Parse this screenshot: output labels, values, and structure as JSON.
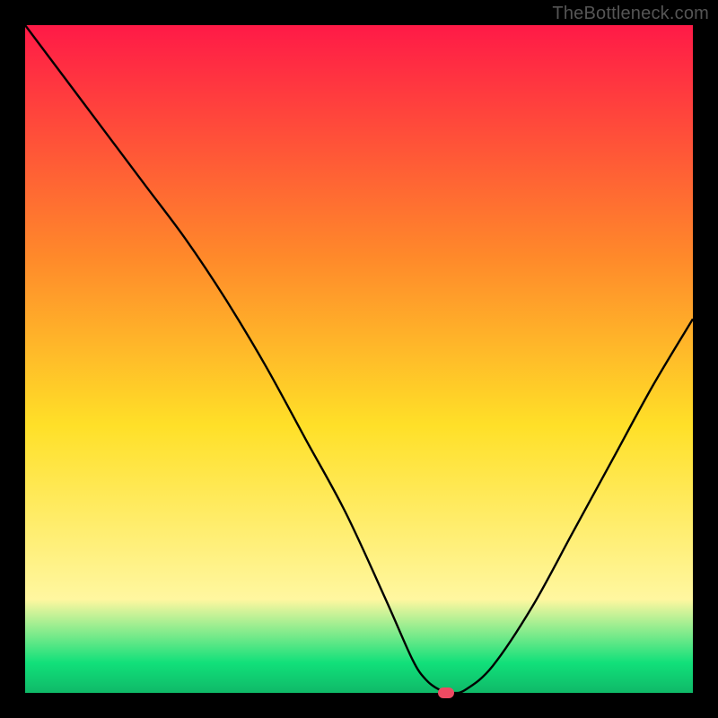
{
  "watermark": "TheBottleneck.com",
  "colors": {
    "frame": "#000000",
    "curve": "#000000",
    "marker": "#ee4a62",
    "gradient_top": "#ff1a47",
    "gradient_mid_upper": "#ff8a2a",
    "gradient_mid": "#ffe028",
    "gradient_lower": "#fff7a0",
    "gradient_green": "#11e07a",
    "gradient_bottom": "#0fb968"
  },
  "chart_data": {
    "type": "line",
    "title": "",
    "xlabel": "",
    "ylabel": "",
    "xlim": [
      0,
      100
    ],
    "ylim": [
      0,
      100
    ],
    "series": [
      {
        "name": "bottleneck-curve",
        "x": [
          0,
          6,
          12,
          18,
          24,
          30,
          36,
          42,
          48,
          54,
          58,
          60,
          62,
          64,
          66,
          70,
          76,
          82,
          88,
          94,
          100
        ],
        "values": [
          100,
          92,
          84,
          76,
          68,
          59,
          49,
          38,
          27,
          14,
          5,
          2,
          0.5,
          0,
          0.5,
          4,
          13,
          24,
          35,
          46,
          56
        ]
      }
    ],
    "annotations": [
      {
        "name": "min-marker",
        "x": 63,
        "y": 0
      }
    ],
    "background_gradient_stops": [
      {
        "offset": 0.0,
        "key": "gradient_top"
      },
      {
        "offset": 0.35,
        "key": "gradient_mid_upper"
      },
      {
        "offset": 0.6,
        "key": "gradient_mid"
      },
      {
        "offset": 0.86,
        "key": "gradient_lower"
      },
      {
        "offset": 0.955,
        "key": "gradient_green"
      },
      {
        "offset": 1.0,
        "key": "gradient_bottom"
      }
    ]
  }
}
